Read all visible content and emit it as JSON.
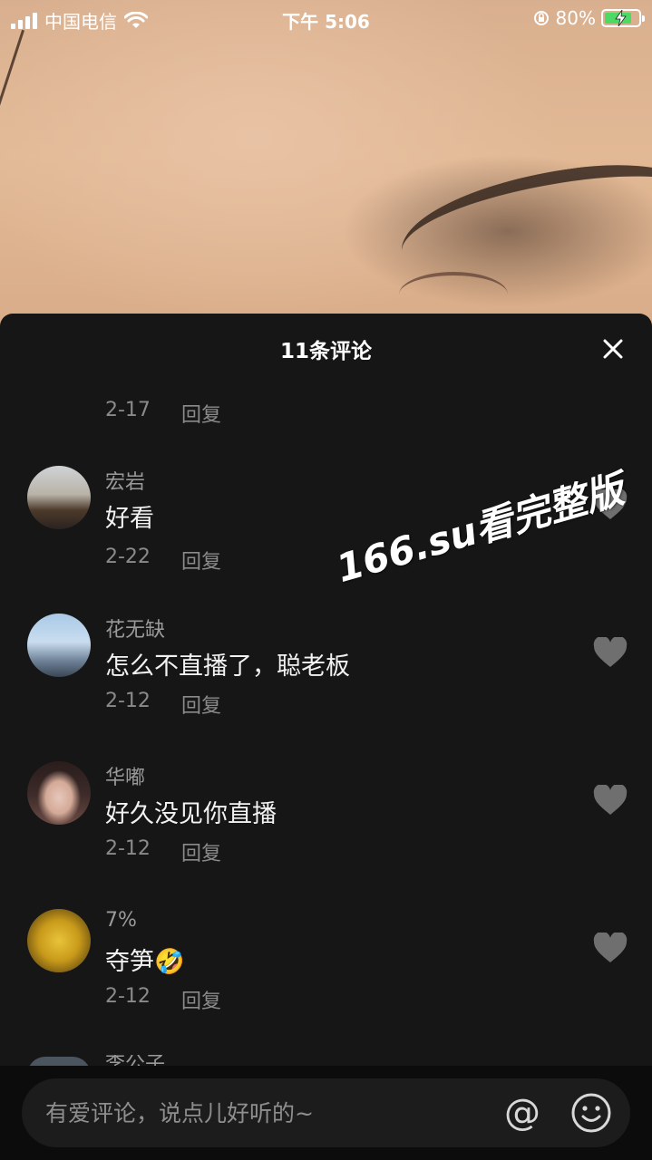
{
  "status_bar": {
    "carrier": "中国电信",
    "time": "下午 5:06",
    "battery_percent": "80%",
    "battery_level": 0.8
  },
  "sheet": {
    "title": "11条评论",
    "close_icon": "close-icon"
  },
  "top_meta": {
    "date": "2-17",
    "reply": "回复"
  },
  "comments": [
    {
      "username": "宏岩",
      "text": "好看",
      "date": "2-22",
      "reply": "回复"
    },
    {
      "username": "花无缺",
      "text": "怎么不直播了，聪老板",
      "date": "2-12",
      "reply": "回复"
    },
    {
      "username": "华嘟",
      "text": "好久没见你直播",
      "date": "2-12",
      "reply": "回复"
    },
    {
      "username": "7%",
      "text": "夺笋",
      "emoji": "🤣",
      "date": "2-12",
      "reply": "回复"
    }
  ],
  "partial_comment": {
    "username": "李公子"
  },
  "watermark": "166.su看完整版",
  "input": {
    "placeholder": "有爱评论，说点儿好听的~",
    "at_label": "@"
  },
  "colors": {
    "sheet_bg": "#161616",
    "battery_green": "#4cd964",
    "meta_gray": "#8a8a8a"
  }
}
